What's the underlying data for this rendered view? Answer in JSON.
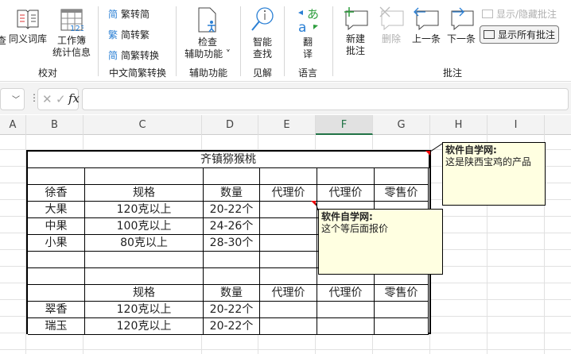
{
  "ribbon": {
    "partial_left": "查",
    "thesaurus": "同义词库",
    "workbook_stats": [
      "工作簿",
      "统计信息"
    ],
    "group_proofing": "校对",
    "trad_to_simp": "繁转简",
    "simp_to_trad": "简转繁",
    "simp_trad_convert": "简繁转换",
    "group_chinese": "中文简繁转换",
    "check_accessibility": [
      "检查",
      "辅助功能 ˅"
    ],
    "group_accessibility": "辅助功能",
    "smart_lookup": [
      "智能",
      "查找"
    ],
    "group_insights": "见解",
    "translate": [
      "翻",
      "译"
    ],
    "group_language": "语言",
    "new_comment": [
      "新建",
      "批注"
    ],
    "delete": "删除",
    "previous": "上一条",
    "next": "下一条",
    "show_hide_comment": "显示/隐藏批注",
    "show_all_comments": "显示所有批注",
    "group_comments": "批注"
  },
  "formula_bar": {
    "fx": "fx",
    "value": ""
  },
  "columns": [
    "A",
    "B",
    "C",
    "D",
    "E",
    "F",
    "G",
    "H",
    "I"
  ],
  "selected_column": "F",
  "table": {
    "title": "齐镇猕猴桃",
    "rows": [
      [
        "",
        "",
        "",
        "",
        "",
        ""
      ],
      [
        "徐香",
        "规格",
        "数量",
        "代理价",
        "代理价",
        "零售价"
      ],
      [
        "大果",
        "120克以上",
        "20-22个",
        "",
        "",
        ""
      ],
      [
        "中果",
        "100克以上",
        "24-26个",
        "",
        "",
        ""
      ],
      [
        "小果",
        "80克以上",
        "28-30个",
        "",
        "",
        ""
      ],
      [
        "",
        "",
        "",
        "",
        "",
        ""
      ],
      [
        "",
        "",
        "",
        "",
        "",
        ""
      ],
      [
        "",
        "规格",
        "数量",
        "代理价",
        "代理价",
        "零售价"
      ],
      [
        "翠香",
        "120克以上",
        "20-22个",
        "",
        "",
        ""
      ],
      [
        "瑞玉",
        "120克以上",
        "20-22个",
        "",
        "",
        ""
      ]
    ]
  },
  "comments": [
    {
      "author": "软件自学网:",
      "text": "这是陕西宝鸡的产品"
    },
    {
      "author": "软件自学网:",
      "text": "这个等后面报价"
    }
  ],
  "colors": {
    "accent": "#217346",
    "comment_bg": "#ffffe1",
    "indicator": "#e00000"
  }
}
